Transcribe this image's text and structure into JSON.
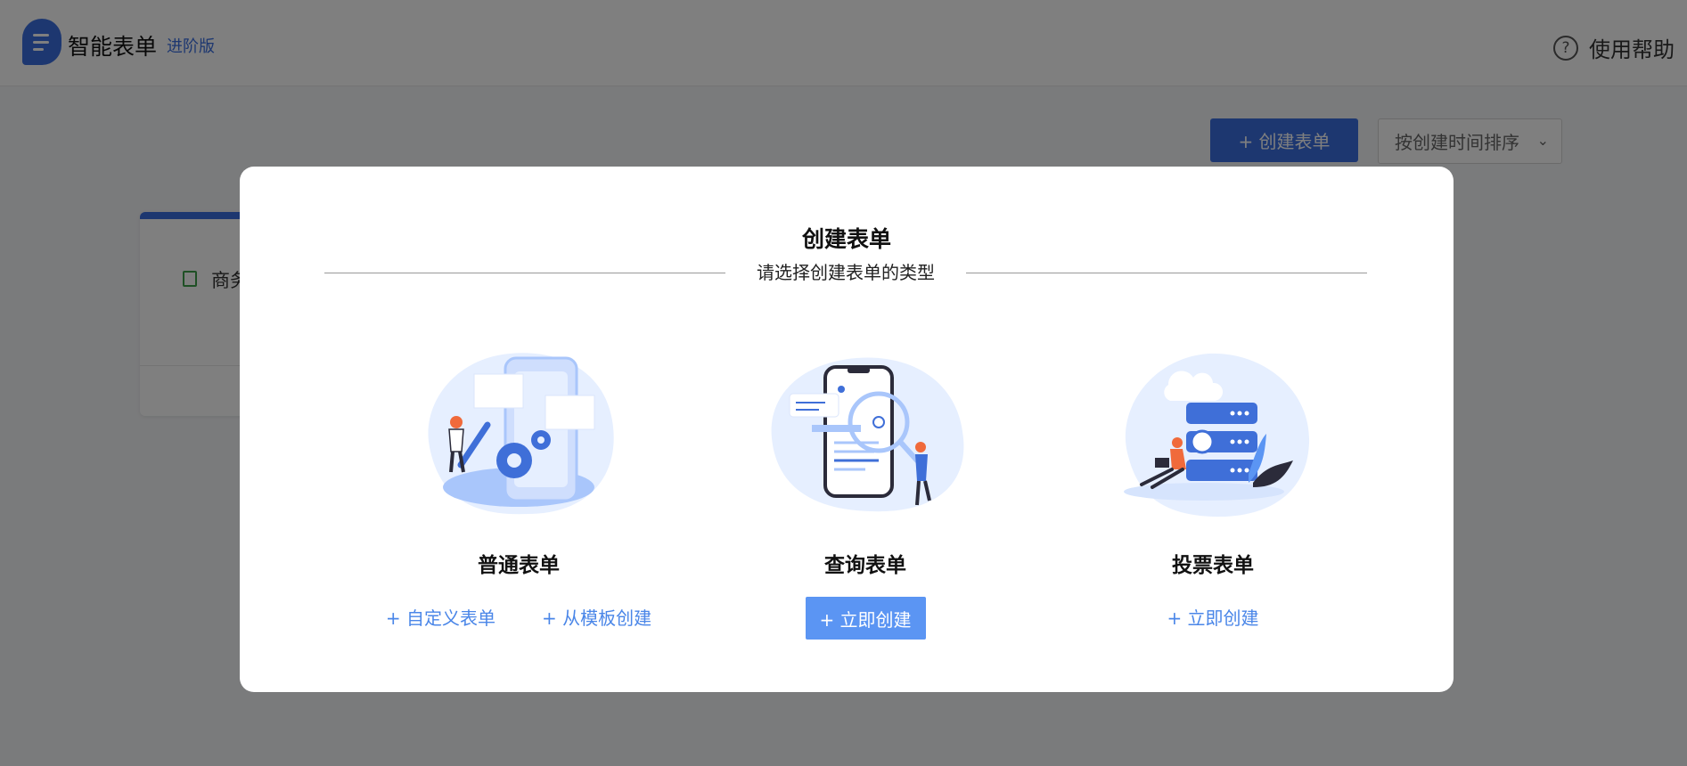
{
  "header": {
    "app_title": "智能表单",
    "app_badge": "进阶版",
    "help_label": "使用帮助",
    "help_glyph": "?"
  },
  "toolbar": {
    "create_label": "+ 创建表单",
    "sort_label": "按创建时间排序"
  },
  "card": {
    "title": "商务"
  },
  "modal": {
    "title": "创建表单",
    "subtitle": "请选择创建表单的类型",
    "types": [
      {
        "title": "普通表单",
        "actions": [
          "+ 自定义表单",
          "+ 从模板创建"
        ]
      },
      {
        "title": "查询表单",
        "actions": [
          "+ 立即创建"
        ]
      },
      {
        "title": "投票表单",
        "actions": [
          "+ 立即创建"
        ]
      }
    ]
  },
  "colors": {
    "brand": "#3b6fe0",
    "link": "#4a86e8",
    "primary_button": "#5b95f3",
    "illustration_light": "#e6efff",
    "illustration_mid": "#a9c6fb",
    "illustration_dark": "#3f6fd8",
    "accent_orange": "#f06a3b"
  },
  "icons": {
    "logo": "form-logo-icon",
    "help": "question-circle-icon",
    "sort": "chevron-down-icon",
    "card": "document-icon"
  }
}
